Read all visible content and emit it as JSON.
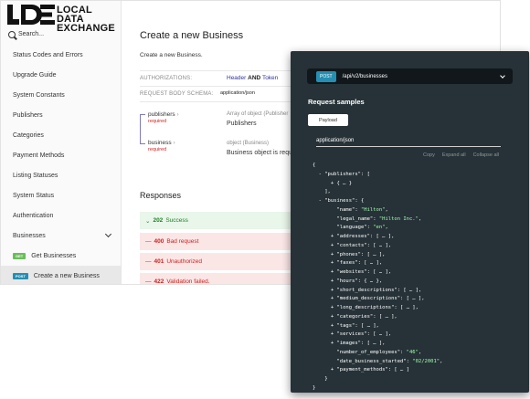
{
  "logo": {
    "line1": "LOCAL DATA",
    "line2": "EXCHANGE"
  },
  "search": {
    "label": "Search..."
  },
  "sidebar": {
    "items": [
      {
        "label": "Status Codes and Errors"
      },
      {
        "label": "Upgrade Guide"
      },
      {
        "label": "System Constants"
      },
      {
        "label": "Publishers"
      },
      {
        "label": "Categories"
      },
      {
        "label": "Payment Methods"
      },
      {
        "label": "Listing Statuses"
      },
      {
        "label": "System Status"
      },
      {
        "label": "Authentication"
      },
      {
        "label": "Businesses"
      }
    ],
    "sub_items": [
      {
        "method": "GET",
        "label": "Get Businesses"
      },
      {
        "method": "POST",
        "label": "Create a new Business"
      }
    ]
  },
  "main": {
    "title": "Create a new Business",
    "description": "Create a new Business.",
    "authorizations_label": "AUTHORIZATIONS:",
    "auth_header": "Header",
    "auth_and": "AND",
    "auth_token": "Token",
    "schema_label": "REQUEST BODY SCHEMA:",
    "schema_value": "application/json",
    "params": [
      {
        "name": "publishers",
        "required": "required",
        "type": "Array of object (Publisher",
        "desc": "Publishers"
      },
      {
        "name": "business",
        "required": "required",
        "type": "object (Business)",
        "desc": "Business object is requ"
      }
    ],
    "responses_title": "Responses",
    "responses": [
      {
        "code": "202",
        "label": "Success"
      },
      {
        "code": "400",
        "label": "Bad request"
      },
      {
        "code": "401",
        "label": "Unauthorized"
      },
      {
        "code": "422",
        "label": "Validation failed."
      }
    ]
  },
  "panel": {
    "method": "POST",
    "path": "/api/v2/businesses",
    "samples_title": "Request samples",
    "tab_label": "Payload",
    "content_type": "application/json",
    "actions": [
      "Copy",
      "Expand all",
      "Collapse all"
    ],
    "code_lines": [
      "{",
      "  - \"publishers\": [",
      "      + { … }",
      "    ],",
      "  - \"business\": {",
      "        \"name\": \"Hilton\",",
      "        \"legal_name\": \"Hilton Inc.\",",
      "        \"language\": \"en\",",
      "      + \"addresses\": [ … ],",
      "      + \"contacts\": [ … ],",
      "      + \"phones\": [ … ],",
      "      + \"faxes\": [ … ],",
      "      + \"websites\": [ … ],",
      "      + \"hours\": { … },",
      "      + \"short_descriptions\": [ … ],",
      "      + \"medium_descriptions\": [ … ],",
      "      + \"long_descriptions\": [ … ],",
      "      + \"categories\": [ … ],",
      "      + \"tags\": [ … ],",
      "      + \"services\": [ … ],",
      "      + \"images\": [ … ],",
      "        \"number_of_employees\": \"46\",",
      "        \"date_business_started\": \"02/2001\",",
      "      + \"payment_methods\": [ … ]",
      "    }",
      "}"
    ]
  },
  "colors": {
    "post": "#248fb2",
    "get": "#6bbd5b",
    "success": "#1d8127",
    "error": "#d41f1c",
    "panel_bg": "#263238",
    "code_string": "#a0fbaa"
  }
}
